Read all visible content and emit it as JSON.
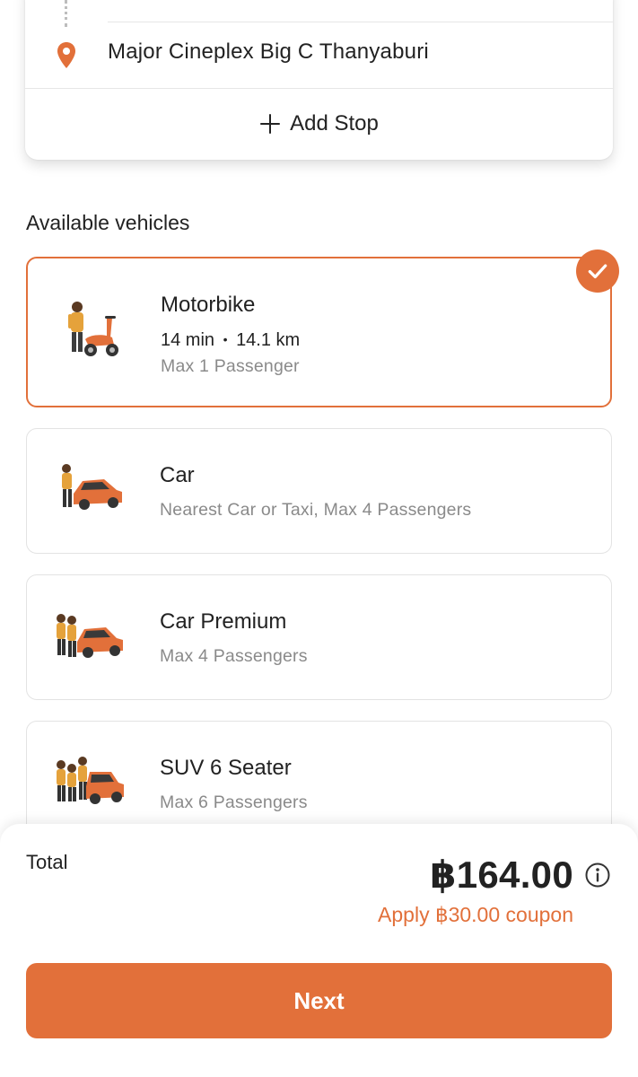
{
  "route": {
    "destination": "Major Cineplex Big C Thanyaburi",
    "add_stop_label": "Add Stop",
    "pin_icon": "location-pin-icon",
    "add_icon": "plus-icon"
  },
  "vehicles_section": {
    "title": "Available vehicles",
    "items": [
      {
        "name": "Motorbike",
        "eta": "14 min",
        "distance": "14.1 km",
        "meta_separator": "•",
        "subtitle": "Max 1 Passenger",
        "selected": true,
        "icon": "motorbike-illustration"
      },
      {
        "name": "Car",
        "subtitle": "Nearest Car or Taxi, Max 4 Passengers",
        "selected": false,
        "icon": "car-illustration"
      },
      {
        "name": "Car Premium",
        "subtitle": "Max 4 Passengers",
        "selected": false,
        "icon": "car-premium-illustration"
      },
      {
        "name": "SUV 6 Seater",
        "subtitle": "Max 6 Passengers",
        "selected": false,
        "icon": "suv-illustration"
      }
    ]
  },
  "summary": {
    "total_label": "Total",
    "price": "฿164.00",
    "coupon_text": "Apply ฿30.00 coupon",
    "next_label": "Next",
    "info_icon": "info-icon",
    "check_icon": "checkmark-icon"
  },
  "colors": {
    "accent": "#e2703a",
    "text": "#222222",
    "muted": "#8a8a8a",
    "border": "#e3e3e3"
  }
}
